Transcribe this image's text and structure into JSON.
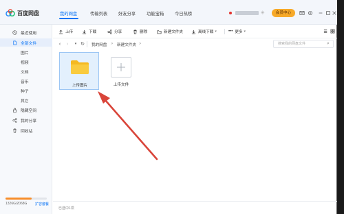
{
  "app": {
    "name": "百度网盘"
  },
  "nav": {
    "tabs": [
      "我的网盘",
      "传输列表",
      "好友分享",
      "功能宝箱",
      "今日热榜"
    ],
    "active": "我的网盘"
  },
  "header": {
    "member_label": "会员中心"
  },
  "sidebar": {
    "items": [
      {
        "label": "最近使用",
        "icon": "clock-icon"
      },
      {
        "label": "全部文件",
        "icon": "file-icon"
      },
      {
        "label": "图片"
      },
      {
        "label": "视频"
      },
      {
        "label": "文档"
      },
      {
        "label": "音乐"
      },
      {
        "label": "种子"
      },
      {
        "label": "其它"
      },
      {
        "label": "隐藏空间",
        "icon": "lock-icon"
      },
      {
        "label": "我的分享",
        "icon": "share-icon"
      },
      {
        "label": "回收站",
        "icon": "trash-icon"
      }
    ],
    "active": "全部文件",
    "storage": {
      "text": "1326G/2068G",
      "used_fraction": 0.64,
      "link": "扩容套餐"
    }
  },
  "toolbar": {
    "upload": "上传",
    "download": "下载",
    "share": "分享",
    "delete": "删除",
    "new_folder": "新建文件夹",
    "offline_download": "离线下载",
    "more": "更多"
  },
  "address": {
    "crumbs": [
      "我的网盘",
      "新建文件夹"
    ],
    "search_placeholder": "搜索我的网盘文件"
  },
  "files": [
    {
      "name": "上传图片",
      "type": "folder",
      "selected": true
    }
  ],
  "upload_tile": {
    "label": "上传文件"
  },
  "status": {
    "text": "已选中1项"
  },
  "colors": {
    "accent": "#0a74f5",
    "folder": "#f7c633",
    "annotation_arrow": "#d9453a"
  }
}
